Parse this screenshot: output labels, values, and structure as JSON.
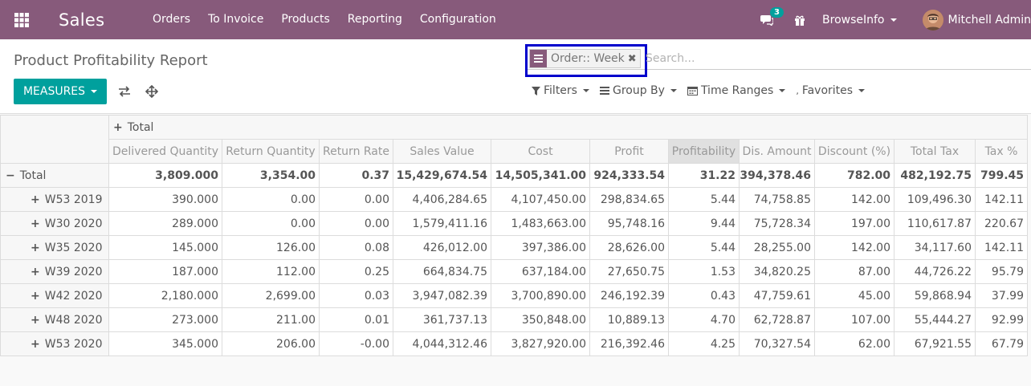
{
  "topbar": {
    "brand": "Sales",
    "menu": [
      "Orders",
      "To Invoice",
      "Products",
      "Reporting",
      "Configuration"
    ],
    "messages_count": "3",
    "company": "BrowseInfo",
    "user": "Mitchell Admin"
  },
  "control_panel": {
    "title": "Product Profitability Report",
    "facet_label": "Order:: Week",
    "facet_remove": "✖",
    "search_placeholder": "Search...",
    "measures_label": "MEASURES",
    "filters_label": "Filters",
    "groupby_label": "Group By",
    "timeranges_label": "Time Ranges",
    "favorites_prefix": ",",
    "favorites_label": "Favorites"
  },
  "pivot": {
    "col_total_label": "Total",
    "columns": [
      "Delivered Quantity",
      "Return Quantity",
      "Return Rate",
      "Sales Value",
      "Cost",
      "Profit",
      "Profitability",
      "Dis. Amount",
      "Discount (%)",
      "Total Tax",
      "Tax %"
    ],
    "total_row": {
      "label": "Total",
      "values": [
        "3,809.000",
        "3,354.00",
        "0.37",
        "15,429,674.54",
        "14,505,341.00",
        "924,333.54",
        "31.22",
        "394,378.46",
        "782.00",
        "482,192.75",
        "799.45"
      ]
    },
    "rows": [
      {
        "label": "W53 2019",
        "values": [
          "390.000",
          "0.00",
          "0.00",
          "4,406,284.65",
          "4,107,450.00",
          "298,834.65",
          "5.44",
          "74,758.85",
          "142.00",
          "109,496.30",
          "142.11"
        ]
      },
      {
        "label": "W30 2020",
        "values": [
          "289.000",
          "0.00",
          "0.00",
          "1,579,411.16",
          "1,483,663.00",
          "95,748.16",
          "9.44",
          "75,728.34",
          "197.00",
          "110,617.87",
          "220.67"
        ]
      },
      {
        "label": "W35 2020",
        "values": [
          "145.000",
          "126.00",
          "0.08",
          "426,012.00",
          "397,386.00",
          "28,626.00",
          "5.44",
          "28,255.00",
          "142.00",
          "34,117.60",
          "142.11"
        ]
      },
      {
        "label": "W39 2020",
        "values": [
          "187.000",
          "112.00",
          "0.25",
          "664,834.75",
          "637,184.00",
          "27,650.75",
          "1.53",
          "34,820.25",
          "87.00",
          "44,726.22",
          "95.79"
        ]
      },
      {
        "label": "W42 2020",
        "values": [
          "2,180.000",
          "2,699.00",
          "0.03",
          "3,947,082.39",
          "3,700,890.00",
          "246,192.39",
          "0.43",
          "47,759.61",
          "45.00",
          "59,868.94",
          "37.99"
        ]
      },
      {
        "label": "W48 2020",
        "values": [
          "273.000",
          "211.00",
          "0.01",
          "361,737.13",
          "350,848.00",
          "10,889.13",
          "4.70",
          "62,728.87",
          "107.00",
          "55,444.27",
          "92.99"
        ]
      },
      {
        "label": "W53 2020",
        "values": [
          "345.000",
          "206.00",
          "-0.00",
          "4,044,312.46",
          "3,827,920.00",
          "216,392.46",
          "4.25",
          "70,327.54",
          "62.00",
          "67,921.55",
          "67.79"
        ]
      }
    ]
  },
  "colors": {
    "brand": "#875a7b",
    "accent": "#00a09d",
    "highlight_frame": "#0000cc"
  }
}
